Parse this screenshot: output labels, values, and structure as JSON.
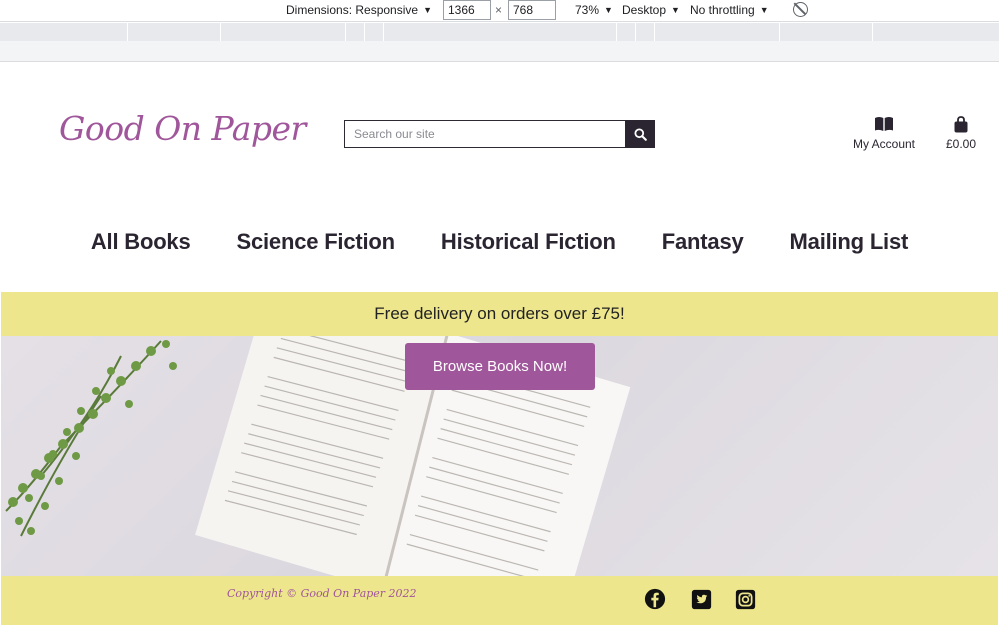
{
  "devtools": {
    "dimensions_label": "Dimensions: Responsive",
    "width_value": "1366",
    "height_value": "768",
    "times": "×",
    "zoom": "73%",
    "device_mode": "Desktop",
    "throttling": "No throttling"
  },
  "site": {
    "logo": "Good On Paper",
    "search": {
      "placeholder": "Search our site"
    },
    "account_label": "My Account",
    "basket_total": "£0.00",
    "nav": [
      "All Books",
      "Science Fiction",
      "Historical Fiction",
      "Fantasy",
      "Mailing List"
    ],
    "promo_text": "Free delivery on orders over £75!",
    "cta_label": "Browse Books Now!",
    "copyright": "Copyright © Good On Paper 2022",
    "social_icons": [
      "facebook-icon",
      "twitter-icon",
      "instagram-icon"
    ]
  },
  "colors": {
    "brand_purple": "#a0569a",
    "banner_yellow": "#ede68c",
    "dark": "#2a2530"
  }
}
